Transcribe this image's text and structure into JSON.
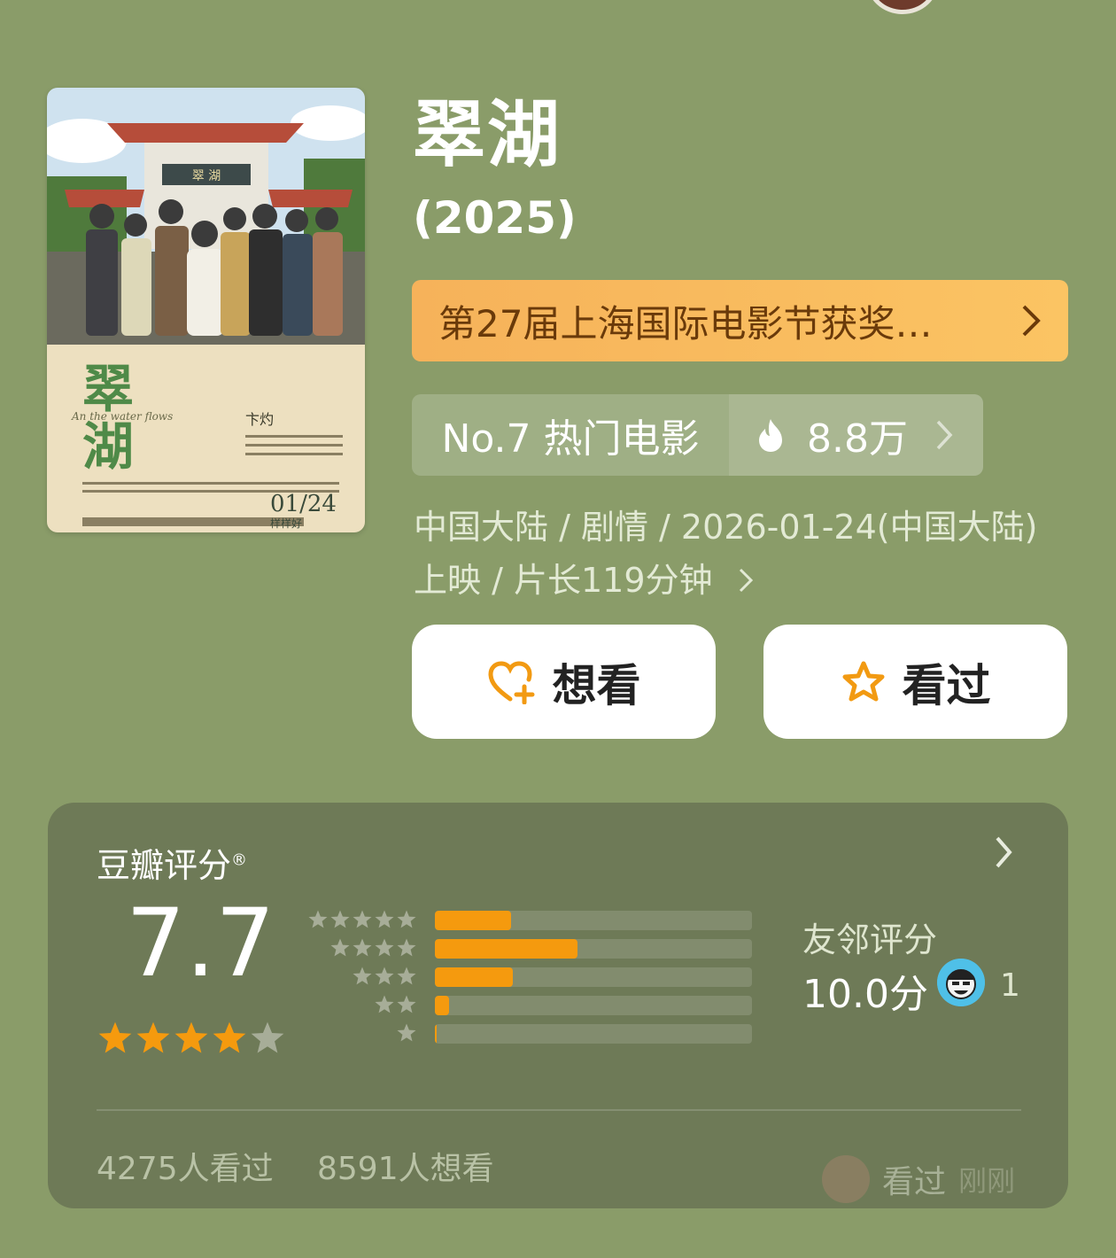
{
  "movie": {
    "title": "翠湖",
    "year": "(2025)",
    "award_banner": "第27届上海国际电影节获奖…",
    "rank_label": "No.7 热门电影",
    "heat": "8.8万",
    "meta_line1": "中国大陆 / 剧情 / 2026-01-24(中国大陆)",
    "meta_line2": "上映 / 片长119分钟"
  },
  "poster": {
    "title_cn": "翠湖",
    "english_script": "An the water flows",
    "director": "卞灼",
    "release_date": "01/24",
    "tagline": "样样好",
    "gate_sign": "翠 湖"
  },
  "actions": {
    "want_label": "想看",
    "seen_label": "看过"
  },
  "rating": {
    "title": "豆瓣评分",
    "mark": "®",
    "score": "7.7",
    "stars_value": 4,
    "distribution": [
      {
        "stars": 5,
        "fraction": 0.24
      },
      {
        "stars": 4,
        "fraction": 0.45
      },
      {
        "stars": 3,
        "fraction": 0.245
      },
      {
        "stars": 2,
        "fraction": 0.045
      },
      {
        "stars": 1,
        "fraction": 0.006
      }
    ],
    "friends_label": "友邻评分",
    "friends_score": "10.0分",
    "friends_count": "1",
    "seen_count": "4275人看过",
    "want_count": "8591人想看",
    "activity_action": "看过",
    "activity_time": "刚刚"
  },
  "colors": {
    "background": "#8a9c69",
    "accent_orange": "#f59a0e",
    "award_bg": "#f8b95d",
    "card_bg": "#6e7a57"
  },
  "icons": {
    "want": "heart-plus-icon",
    "seen": "star-outline-icon",
    "heat": "flame-icon"
  }
}
